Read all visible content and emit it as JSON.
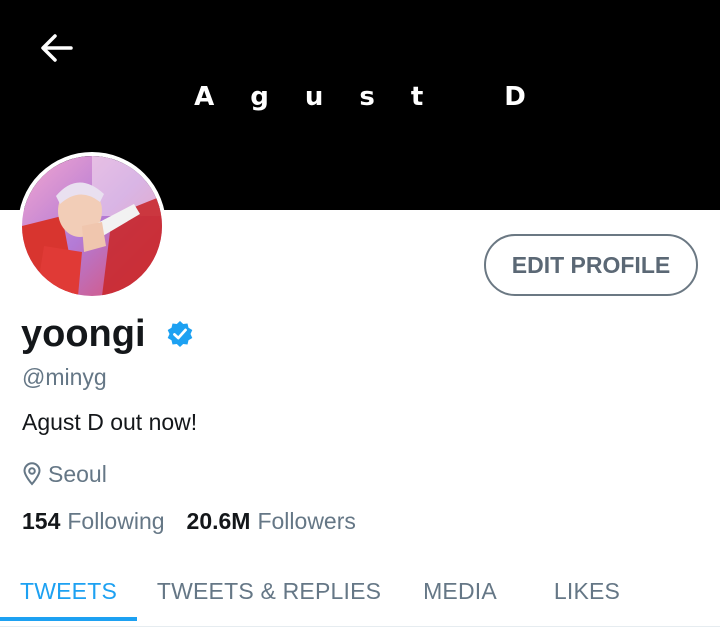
{
  "header": {
    "banner_text": "Agust D",
    "back_icon": "arrow-left-icon",
    "background": "#000000"
  },
  "profile": {
    "avatar_icon": "profile-photo",
    "edit_label": "EDIT PROFILE",
    "name": "yoongi",
    "verified_icon": "verified-badge-icon",
    "handle": "@minyg",
    "bio": "Agust D out now!",
    "location_icon": "location-pin-icon",
    "location": "Seoul",
    "following_count": "154",
    "following_label": "Following",
    "followers_count": "20.6M",
    "followers_label": "Followers"
  },
  "tabs": [
    {
      "label": "TWEETS",
      "active": true
    },
    {
      "label": "TWEETS & REPLIES",
      "active": false
    },
    {
      "label": "MEDIA",
      "active": false
    },
    {
      "label": "LIKES",
      "active": false
    }
  ],
  "colors": {
    "accent": "#1da1f2",
    "text_primary": "#14171a",
    "text_secondary": "#657786"
  }
}
